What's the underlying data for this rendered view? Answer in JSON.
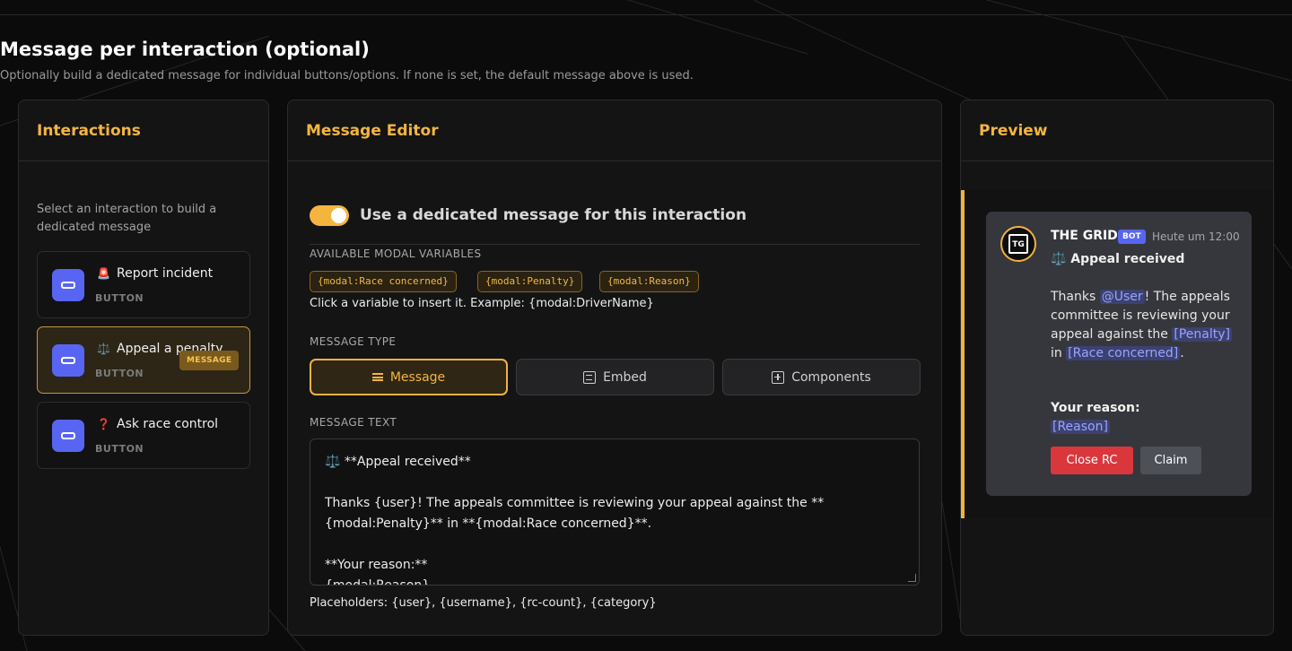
{
  "section": {
    "title": "Message per interaction (optional)",
    "subtitle": "Optionally build a dedicated message for individual buttons/options. If none is set, the default message above is used."
  },
  "interactions": {
    "heading": "Interactions",
    "hint": "Select an interaction to build a dedicated message",
    "items": [
      {
        "emoji": "🚨",
        "label": "Report incident",
        "type": "BUTTON",
        "active": false
      },
      {
        "emoji": "⚖️",
        "label": "Appeal a penalty",
        "type": "BUTTON",
        "active": true,
        "badge": "MESSAGE"
      },
      {
        "emoji": "❓",
        "label": "Ask race control",
        "type": "BUTTON",
        "active": false
      }
    ]
  },
  "editor": {
    "heading": "Message Editor",
    "toggle_label": "Use a dedicated message for this interaction",
    "toggle_on": true,
    "vars_label": "AVAILABLE MODAL VARIABLES",
    "variables": [
      "{modal:Race concerned}",
      "{modal:Penalty}",
      "{modal:Reason}"
    ],
    "vars_hint": "Click a variable to insert it. Example: {modal:DriverName}",
    "type_label": "MESSAGE TYPE",
    "types": [
      {
        "label": "Message",
        "icon": "lines-icon",
        "active": true
      },
      {
        "label": "Embed",
        "icon": "embed-icon",
        "active": false
      },
      {
        "label": "Components",
        "icon": "components-icon",
        "active": false
      }
    ],
    "text_label": "MESSAGE TEXT",
    "text_lines": [
      "⚖️ **Appeal received**",
      "",
      "Thanks {user}! The appeals committee is reviewing your appeal against the **",
      "{modal:Penalty}** in **{modal:Race concerned}**.",
      "",
      "**Your reason:**",
      "{modal:Reason}"
    ],
    "placeholders": "Placeholders: {user}, {username}, {rc-count}, {category}"
  },
  "preview": {
    "heading": "Preview",
    "accent_color": "#f0b145",
    "bot_name": "THE GRID",
    "bot_badge": "BOT",
    "timestamp": "Heute um 12:00",
    "avatar_text": "TG",
    "embed_title": "⚖️ Appeal received",
    "body": {
      "t1": "Thanks ",
      "mention_user": "@User",
      "t2": "! The appeals committee is reviewing your appeal against the ",
      "mention_penalty": "[Penalty]",
      "t3": " in ",
      "mention_race": "[Race concerned]",
      "t4": "."
    },
    "reason_title": "Your reason:",
    "reason_value": "[Reason]",
    "buttons": {
      "close": "Close RC",
      "claim": "Claim"
    }
  }
}
